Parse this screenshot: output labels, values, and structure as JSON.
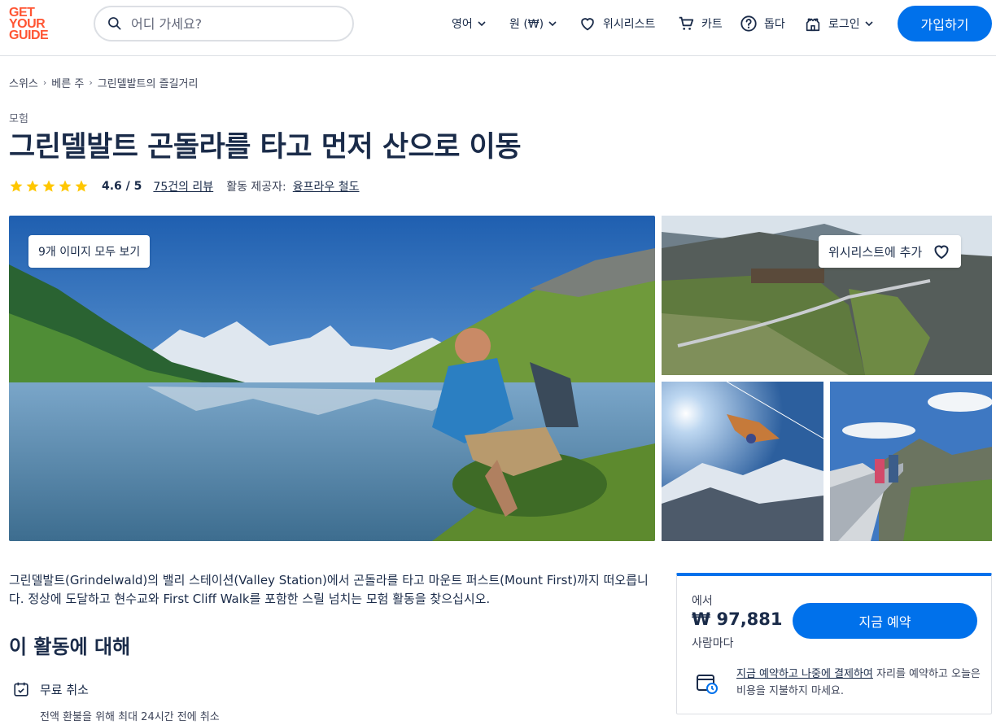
{
  "header": {
    "logo_lines": [
      "GET",
      "YOUR",
      "GUIDE"
    ],
    "search_placeholder": "어디 가세요?",
    "language_label": "영어",
    "currency_label": "원 (₩)",
    "wishlist_label": "위시리스트",
    "cart_label": "카트",
    "help_label": "돕다",
    "login_label": "로그인",
    "signup_label": "가입하기"
  },
  "breadcrumb": [
    "스위스",
    "베른 주",
    "그린델발트의 즐길거리"
  ],
  "activity": {
    "category": "모험",
    "title": "그린델발트 곤돌라를 타고 먼저 산으로 이동",
    "rating": "4.6 / 5",
    "rating_value": 4.6,
    "stars": 5,
    "reviews": "75건의 리뷰",
    "provider_label": "활동 제공자:",
    "provider": "융프라우 철도"
  },
  "gallery": {
    "view_all_label": "9개 이미지 모두 보기",
    "wishlist_add_label": "위시리스트에 추가"
  },
  "description": "그린델발트(Grindelwald)의 밸리 스테이션(Valley Station)에서 곤돌라를 타고 마운트 퍼스트(Mount First)까지 떠오릅니다. 정상에 도달하고 현수교와 First Cliff Walk를 포함한 스릴 넘치는 모험 활동을 찾으십시오.",
  "about": {
    "title": "이 활동에 대해",
    "features": [
      {
        "icon": "calendar-check-icon",
        "title": "무료 취소",
        "subtitle": "전액 환불을 위해 최대 24시간 전에 취소"
      }
    ]
  },
  "booking": {
    "from_label": "에서",
    "price": "₩ 97,881",
    "per_person": "사람마다",
    "book_label": "지금 예약",
    "reserve_link": "지금 예약하고 나중에 결제하여",
    "reserve_text": " 자리를 예약하고 오늘은 비용을 지불하지 마세요."
  },
  "colors": {
    "brand_orange": "#ff5533",
    "primary_blue": "#0071eb",
    "star_yellow": "#ffc700",
    "text_dark": "#1a2b49"
  }
}
